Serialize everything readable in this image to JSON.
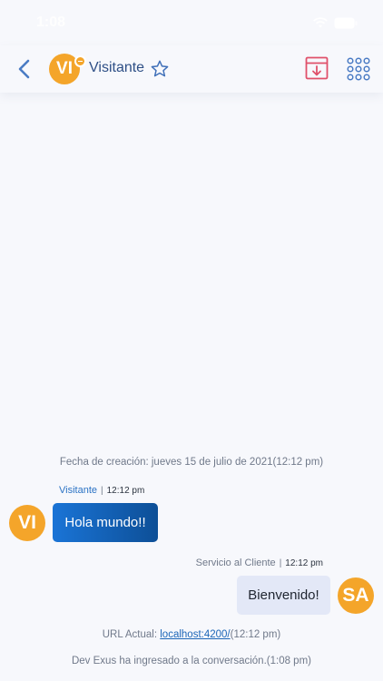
{
  "status_bar": {
    "time": "1:08"
  },
  "header": {
    "avatar_initials": "VI",
    "title": "Visitante"
  },
  "conversation": {
    "created_line": "Fecha de creación: jueves 15 de julio de 2021(12:12 pm)",
    "messages": [
      {
        "sender": "Visitante",
        "separator": "|",
        "time": "12:12 pm",
        "text": "Hola mundo!!",
        "avatar": "VI",
        "direction": "incoming"
      },
      {
        "sender": "Servicio al Cliente",
        "separator": "|",
        "time": "12:12 pm",
        "text": "Bienvenido!",
        "avatar": "SA",
        "direction": "outgoing"
      }
    ],
    "url_line": {
      "prefix": "URL Actual: ",
      "link": "localhost:4200/",
      "suffix": "(12:12 pm)"
    },
    "joined_line": "Dev Exus ha ingresado a la conversación.(1:08 pm)"
  },
  "colors": {
    "accent": "#f4a52a",
    "primary_blue": "#1a74d6",
    "archive_pink": "#e0506a",
    "icon_blue": "#4a7bc4"
  },
  "icons": [
    "wifi-icon",
    "battery-icon",
    "back-arrow-icon",
    "star-icon",
    "archive-icon",
    "apps-grid-icon"
  ]
}
